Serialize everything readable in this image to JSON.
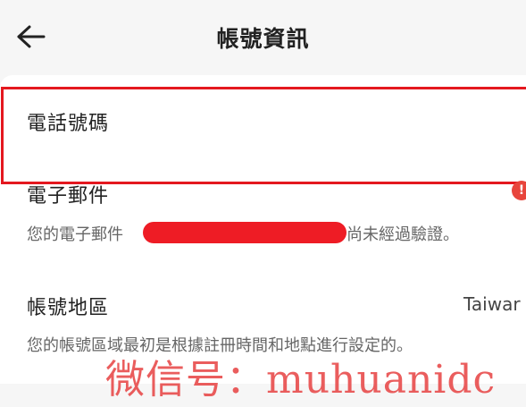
{
  "header": {
    "title": "帳號資訊",
    "back_icon": "arrow-left-icon"
  },
  "rows": {
    "phone": {
      "label": "電話號碼"
    },
    "email": {
      "label": "電子郵件",
      "desc_prefix": "您的電子郵件",
      "desc_suffix": "尚未經過驗證。",
      "alert_icon": "alert-icon",
      "alert_glyph": "!"
    },
    "region": {
      "label": "帳號地區",
      "value": "Taiwar",
      "desc": "您的帳號區域最初是根據註冊時間和地點進行設定的。"
    }
  },
  "watermark": "微信号：muhuanidc",
  "colors": {
    "highlight": "#e4181f",
    "redaction": "#ee1c25",
    "background": "#f6f6f6"
  }
}
